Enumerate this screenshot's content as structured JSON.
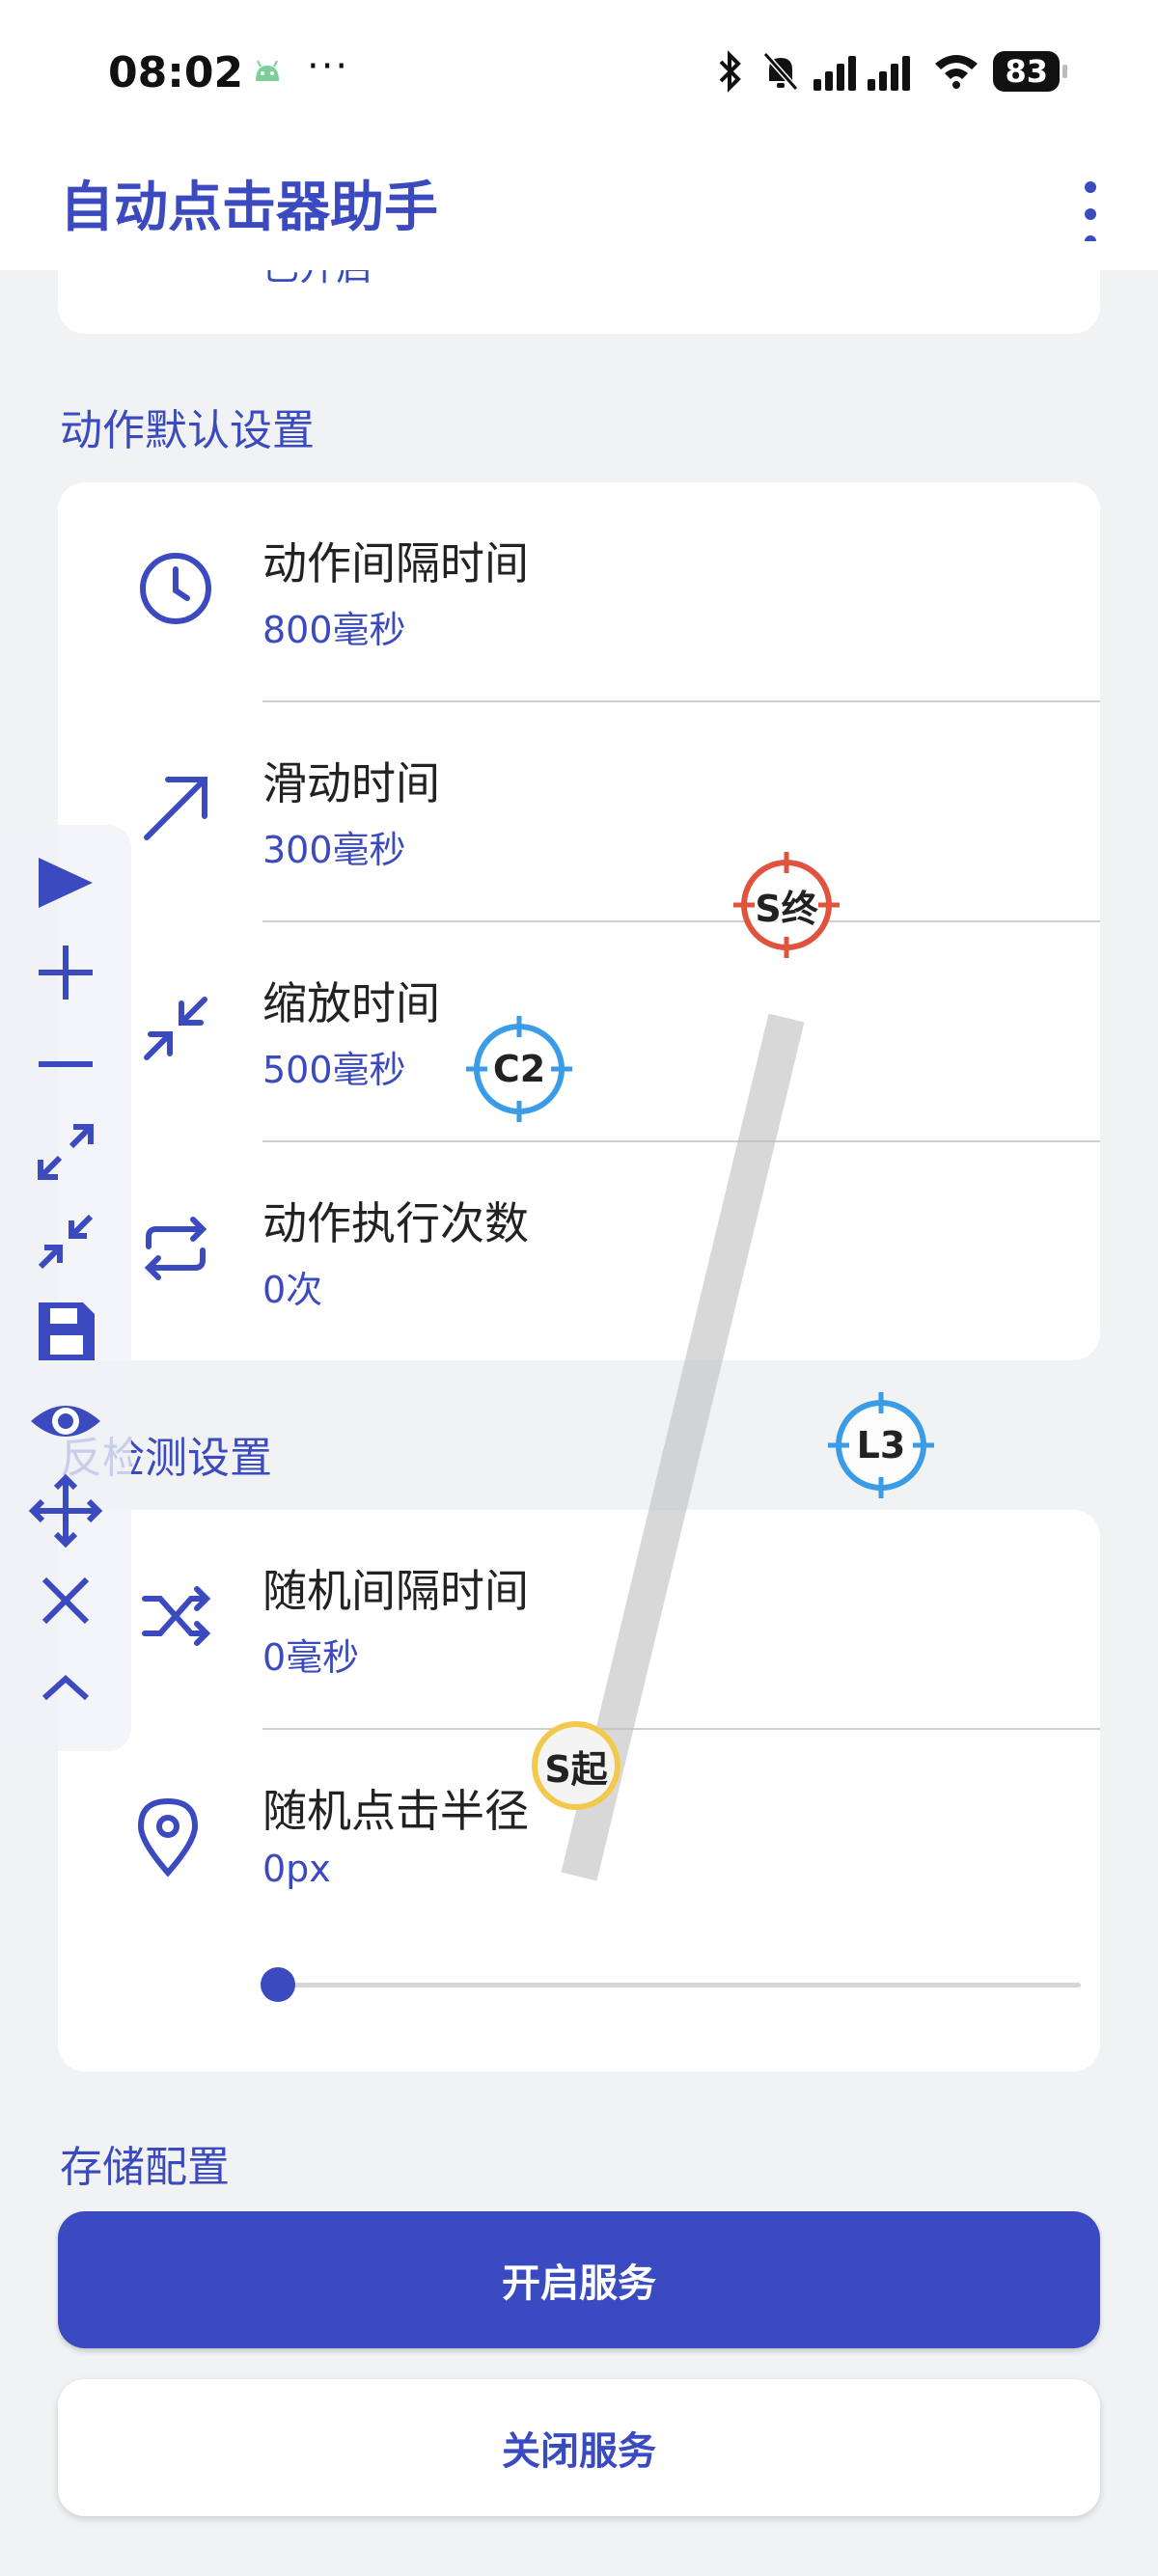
{
  "status_bar": {
    "time": "08:02",
    "dots": "···",
    "battery": "83"
  },
  "app_bar": {
    "title": "自动点击器助手"
  },
  "top_card": {
    "value_partial": "已开启"
  },
  "action_defaults": {
    "section_title": "动作默认设置",
    "rows": [
      {
        "title": "动作间隔时间",
        "value": "800毫秒",
        "icon": "clock-icon"
      },
      {
        "title": "滑动时间",
        "value": "300毫秒",
        "icon": "arrow-up-right-icon"
      },
      {
        "title": "缩放时间",
        "value": "500毫秒",
        "icon": "collapse-icon"
      },
      {
        "title": "动作执行次数",
        "value": "0次",
        "icon": "repeat-icon"
      }
    ]
  },
  "anti_detect": {
    "section_title": "反检测设置",
    "section_title_visible": "反检测设置",
    "rows": [
      {
        "title": "随机间隔时间",
        "value": "0毫秒",
        "icon": "shuffle-icon"
      },
      {
        "title": "随机点击半径",
        "value": "0px",
        "icon": "location-pin-icon"
      }
    ],
    "radius_slider_fraction": 0
  },
  "storage": {
    "section_title": "存储配置"
  },
  "buttons": {
    "start": "开启服务",
    "stop": "关闭服务"
  },
  "markers": {
    "swipe_end": "S终",
    "click_2": "C2",
    "long_press_3": "L3",
    "swipe_start": "S起"
  },
  "colors": {
    "accent": "#3b4bbf",
    "marker_red": "#e0533d",
    "marker_blue": "#3a9be6",
    "marker_yellow": "#f2c94c"
  }
}
